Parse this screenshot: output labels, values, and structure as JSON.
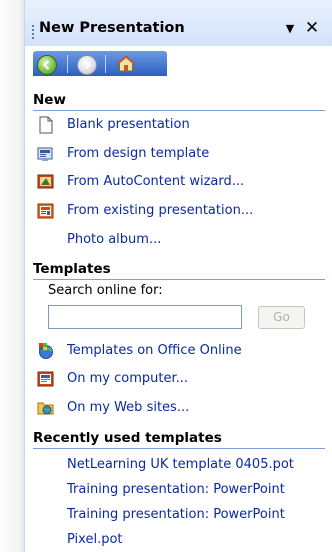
{
  "pane": {
    "title": "New Presentation",
    "dropdown_glyph": "▼",
    "close_glyph": "✕"
  },
  "navigation": {
    "back_icon": "back-arrow-icon",
    "forward_icon": "forward-arrow-icon",
    "home_icon": "home-icon"
  },
  "sections": {
    "new": {
      "heading": "New",
      "items": [
        {
          "label": "Blank presentation",
          "icon": "blank-page-icon"
        },
        {
          "label": "From design template",
          "icon": "design-template-icon"
        },
        {
          "label": "From AutoContent wizard...",
          "icon": "autocontent-wizard-icon"
        },
        {
          "label": "From existing presentation...",
          "icon": "existing-presentation-icon"
        },
        {
          "label": "Photo album...",
          "icon": ""
        }
      ]
    },
    "templates": {
      "heading": "Templates",
      "search_label": "Search online for:",
      "search_value": "",
      "go_label": "Go",
      "items": [
        {
          "label": "Templates on Office Online",
          "icon": "office-online-icon"
        },
        {
          "label": "On my computer...",
          "icon": "my-computer-icon"
        },
        {
          "label": "On my Web sites...",
          "icon": "web-sites-icon"
        }
      ]
    },
    "recent": {
      "heading": "Recently used templates",
      "items": [
        {
          "label": "NetLearning UK template 0405.pot"
        },
        {
          "label": "Training presentation: PowerPoint"
        },
        {
          "label": "Training presentation: PowerPoint"
        },
        {
          "label": "Pixel.pot"
        }
      ]
    }
  },
  "colors": {
    "link": "#0a2aa0",
    "title_gradient_top": "#e9f1fd",
    "title_gradient_bottom": "#d3e2fa",
    "navbar": "#2c5fc0",
    "section_rule": "#7fa2d6"
  }
}
